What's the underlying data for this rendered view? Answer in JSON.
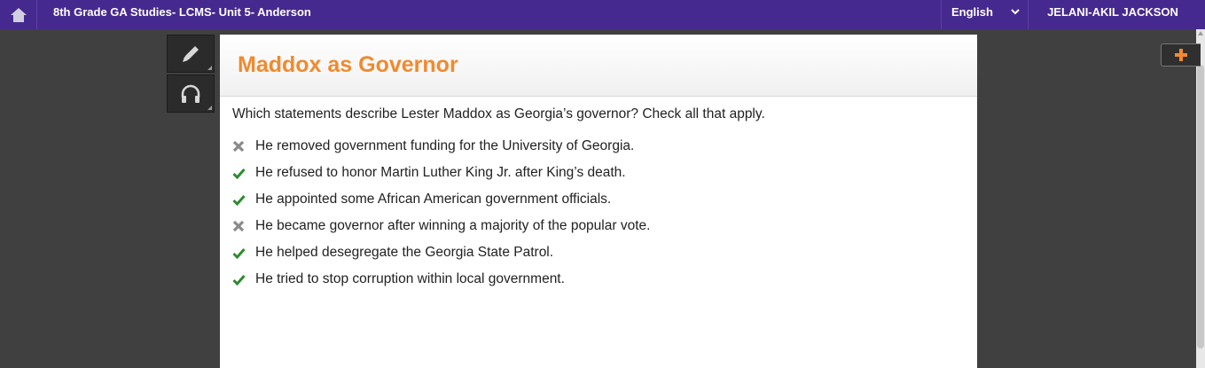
{
  "header": {
    "course_title": "8th Grade GA Studies- LCMS- Unit 5- Anderson",
    "language": "English",
    "user_name": "JELANI-AKIL JACKSON"
  },
  "tools": {
    "pencil": "pencil-icon",
    "audio": "headphones-icon"
  },
  "panel": {
    "title": "Maddox as Governor",
    "question": "Which statements describe Lester Maddox as Georgia’s governor? Check all that apply.",
    "answers": [
      {
        "text": "He removed government funding for the University of Georgia.",
        "mark": "incorrect"
      },
      {
        "text": "He refused to honor Martin Luther King Jr. after King’s death.",
        "mark": "correct"
      },
      {
        "text": "He appointed some African American government officials.",
        "mark": "correct"
      },
      {
        "text": "He became governor after winning a majority of the popular vote.",
        "mark": "incorrect"
      },
      {
        "text": "He helped desegregate the Georgia State Patrol.",
        "mark": "correct"
      },
      {
        "text": "He tried to stop corruption within local government.",
        "mark": "correct"
      }
    ]
  },
  "colors": {
    "topbar": "#46298e",
    "title": "#f08a2e",
    "check": "#2e8b2e",
    "cross": "#8a8a8a",
    "plus": "#f08a2e"
  }
}
